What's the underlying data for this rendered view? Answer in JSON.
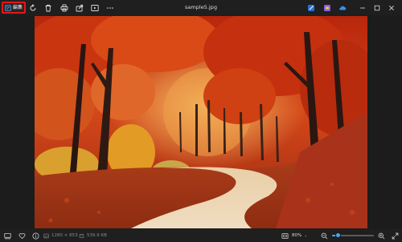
{
  "toolbar": {
    "edit_label": "編集",
    "icons": [
      "edit-image-icon",
      "rotate-icon",
      "delete-icon",
      "print-icon",
      "share-icon",
      "slideshow-icon",
      "more-icon"
    ]
  },
  "window": {
    "title": "sample5.jpg",
    "app_icons": [
      "ai-edit-icon",
      "clipchamp-icon",
      "onedrive-icon"
    ],
    "controls": [
      "minimize",
      "maximize",
      "close"
    ]
  },
  "statusbar": {
    "dimensions": "1280 × 853",
    "file_size": "539.9 KB",
    "zoom_label": "80%",
    "zoom_value": 0.15
  },
  "colors": {
    "accent": "#4aa3f0",
    "highlight_border": "#e8141b",
    "background": "#1c1c1c"
  }
}
